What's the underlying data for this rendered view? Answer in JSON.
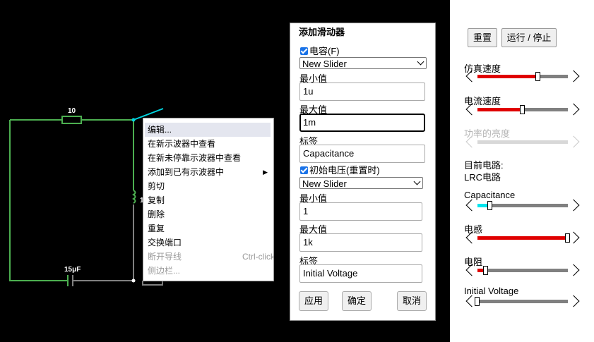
{
  "circuit": {
    "resistor_label": "10",
    "capacitor_label": "15μF",
    "inductor_label_partial": "1",
    "wire_color": "#4caf50",
    "selected_wire_color": "#00d4e0"
  },
  "context_menu": {
    "items": [
      {
        "label": "编辑...",
        "state": "highlighted"
      },
      {
        "label": "在新示波器中查看",
        "state": "normal"
      },
      {
        "label": "在新未停靠示波器中查看",
        "state": "normal"
      },
      {
        "label": "添加到已有示波器中",
        "state": "normal",
        "submenu": true
      },
      {
        "label": "剪切",
        "state": "normal"
      },
      {
        "label": "复制",
        "state": "normal"
      },
      {
        "label": "删除",
        "state": "normal"
      },
      {
        "label": "重复",
        "state": "normal"
      },
      {
        "label": "交换端口",
        "state": "normal"
      },
      {
        "label": "断开导线",
        "state": "disabled",
        "shortcut": "Ctrl-click"
      },
      {
        "label": "侧边栏...",
        "state": "disabled"
      }
    ]
  },
  "dialog": {
    "title": "添加滑动器",
    "section1": {
      "checkbox_label": "电容(F)",
      "checked": true,
      "select_value": "New Slider",
      "min_label": "最小值",
      "min_value": "1u",
      "max_label": "最大值",
      "max_value": "1m",
      "tag_label": "标签",
      "tag_value": "Capacitance"
    },
    "section2": {
      "checkbox_label": "初始电压(重置时)",
      "checked": true,
      "select_value": "New Slider",
      "min_label": "最小值",
      "min_value": "1",
      "max_label": "最大值",
      "max_value": "1k",
      "tag_label": "标签",
      "tag_value": "Initial Voltage"
    },
    "buttons": {
      "apply": "应用",
      "ok": "确定",
      "cancel": "取消"
    }
  },
  "panel": {
    "reset_label": "重置",
    "run_stop_label": "运行 / 停止",
    "current_circuit_label": "目前电路:",
    "current_circuit_name": "LRC电路",
    "sliders": [
      {
        "label": "仿真速度",
        "value": 0.67,
        "color": "#e00000",
        "disabled": false
      },
      {
        "label": "电流速度",
        "value": 0.5,
        "color": "#e00000",
        "disabled": false
      },
      {
        "label": "功率的亮度",
        "value": 0.5,
        "color": "#d8d8d8",
        "disabled": true
      },
      {
        "label": "Capacitance",
        "value": 0.14,
        "color": "#00e5ee",
        "disabled": false
      },
      {
        "label": "电感",
        "value": 1.0,
        "color": "#e00000",
        "disabled": false
      },
      {
        "label": "电阻",
        "value": 0.09,
        "color": "#e00000",
        "disabled": false
      },
      {
        "label": "Initial Voltage",
        "value": 0.0,
        "color": "#e00000",
        "disabled": false
      }
    ]
  }
}
